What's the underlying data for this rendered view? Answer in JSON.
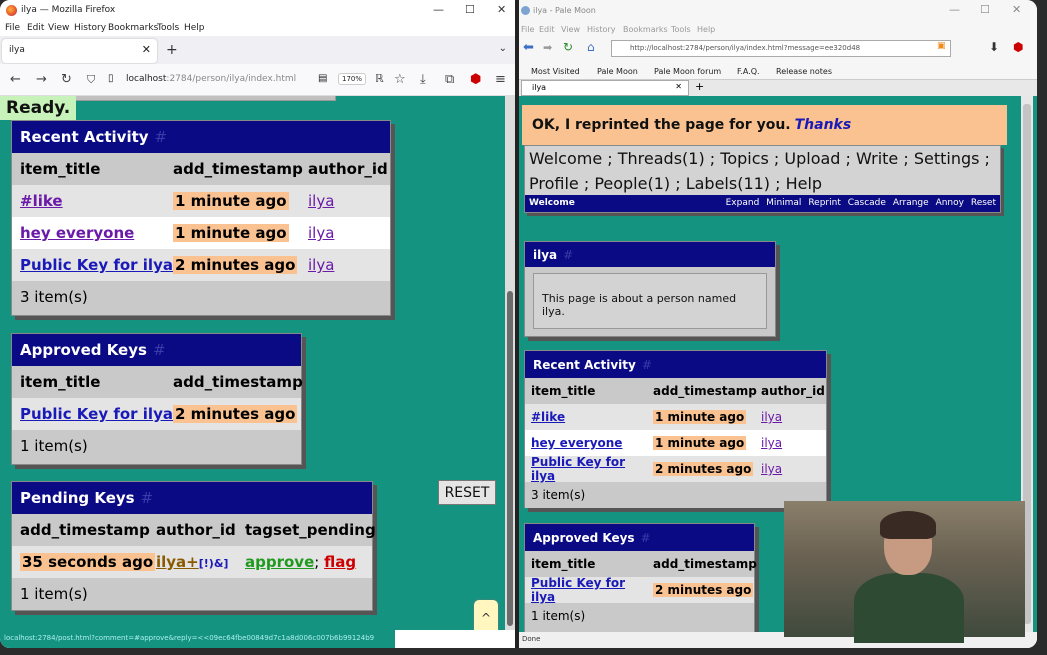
{
  "left": {
    "window_title": "ilya — Mozilla Firefox",
    "menu": [
      "File",
      "Edit",
      "View",
      "History",
      "Bookmarks",
      "Tools",
      "Help"
    ],
    "tab_title": "ilya",
    "url_host": "localhost",
    "url_rest": ":2784/person/ilya/index.html",
    "zoom": "170%",
    "ready": "Ready.",
    "status_url": "localhost:2784/post.html?comment=#approve&reply=<<09ec64fbe00849d7c1a8d006c007b6b99124b9",
    "recent": {
      "title": "Recent Activity",
      "hash": "#",
      "headers": [
        "item_title",
        "add_timestamp",
        "author_id"
      ],
      "rows": [
        {
          "title": "#like",
          "ts": "1 minute ago",
          "author": "ilya"
        },
        {
          "title": "hey everyone",
          "ts": "1 minute ago",
          "author": "ilya"
        },
        {
          "title": "Public Key for ilya",
          "ts": "2 minutes ago",
          "author": "ilya"
        }
      ],
      "count": "3 item(s)"
    },
    "approved": {
      "title": "Approved Keys",
      "hash": "#",
      "headers": [
        "item_title",
        "add_timestamp"
      ],
      "rows": [
        {
          "title": "Public Key for ilya",
          "ts": "2 minutes ago"
        }
      ],
      "count": "1 item(s)"
    },
    "pending": {
      "title": "Pending Keys",
      "hash": "#",
      "headers": [
        "add_timestamp",
        "author_id",
        "tagset_pending"
      ],
      "row": {
        "ts": "35 seconds ago",
        "author": "ilya+",
        "author_tail": "[!)&]",
        "approve": "approve",
        "sep": ";",
        "flag": "flag"
      },
      "count": "1 item(s)"
    },
    "reset": "RESET",
    "up": "^"
  },
  "right": {
    "window_title": "ilya - Pale Moon",
    "menu": [
      "File",
      "Edit",
      "View",
      "History",
      "Bookmarks",
      "Tools",
      "Help"
    ],
    "url": "http://localhost:2784/person/ilya/index.html?message=ee320d48",
    "bookmarks": [
      "Most Visited",
      "Pale Moon",
      "Pale Moon forum",
      "F.A.Q.",
      "Release notes"
    ],
    "tab_title": "ilya",
    "ok_message": "OK, I reprinted the page for you.",
    "ok_link": "Thanks",
    "nav_line1": "Welcome ; Threads(1) ; Topics ; Upload ; Write ; Settings ;",
    "nav_line2": "Profile ; People(1) ; Labels(11) ; Help",
    "bar_left": "Welcome",
    "bar_links": [
      "Expand",
      "Minimal",
      "Reprint",
      "Cascade",
      "Arrange",
      "Annoy",
      "Reset"
    ],
    "person": {
      "title": "ilya",
      "hash": "#",
      "text": "This page is about a person named ilya."
    },
    "recent": {
      "title": "Recent Activity",
      "hash": "#",
      "headers": [
        "item_title",
        "add_timestamp",
        "author_id"
      ],
      "rows": [
        {
          "title": "#like",
          "ts": "1 minute ago",
          "author": "ilya"
        },
        {
          "title": "hey everyone",
          "ts": "1 minute ago",
          "author": "ilya"
        },
        {
          "title": "Public Key for ilya",
          "ts": "2 minutes ago",
          "author": "ilya"
        }
      ],
      "count": "3 item(s)"
    },
    "approved": {
      "title": "Approved Keys",
      "hash": "#",
      "headers": [
        "item_title",
        "add_timestamp"
      ],
      "rows": [
        {
          "title": "Public Key for ilya",
          "ts": "2 minutes ago"
        }
      ],
      "count": "1 item(s)"
    },
    "status": "Done"
  },
  "colors": {
    "page_bg": "#149480",
    "header_bg": "#0a0a85",
    "timestamp_bg": "#f9c290",
    "ready_bg": "#c7f2b9"
  }
}
